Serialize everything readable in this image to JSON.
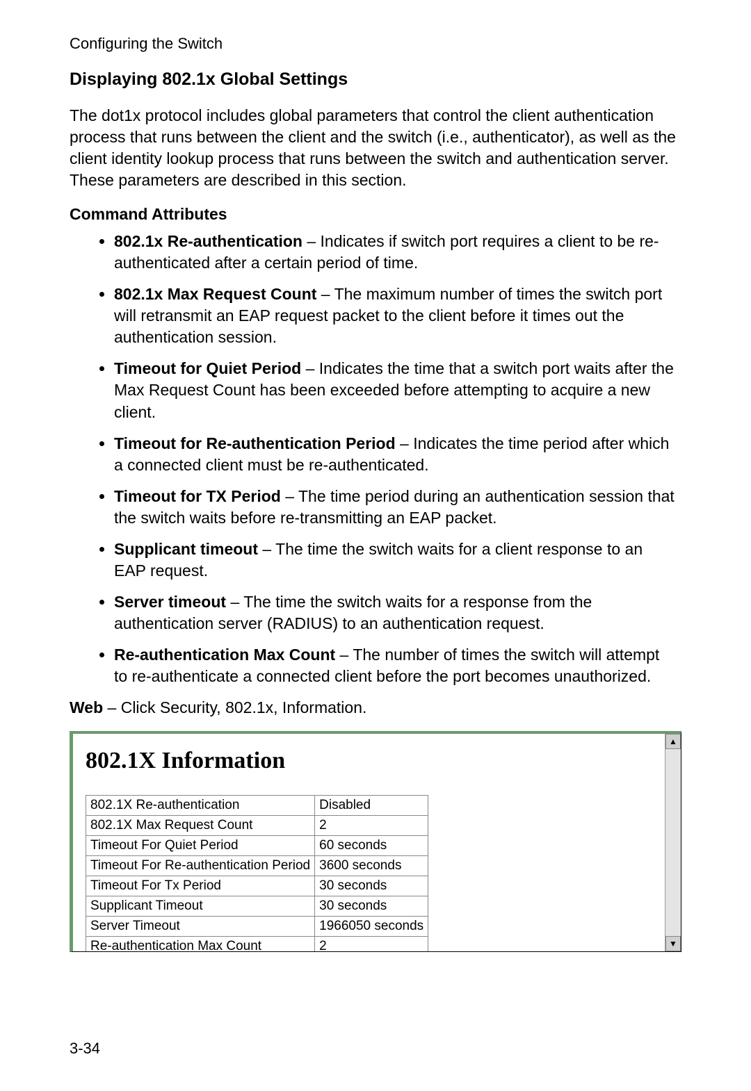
{
  "header": "Configuring the Switch",
  "section_title": "Displaying 802.1x Global Settings",
  "intro": "The dot1x protocol includes global parameters that control the client authentication process that runs between the client and the switch (i.e., authenticator), as well as the client identity lookup process that runs between the switch and authentication server. These parameters are described in this section.",
  "cmd_heading": "Command Attributes",
  "attrs": [
    {
      "term": "802.1x Re-authentication",
      "desc": " – Indicates if switch port requires a client to be re-authenticated after a certain period of time."
    },
    {
      "term": "802.1x Max Request Count",
      "desc": " – The maximum number of times the switch port will retransmit an EAP request packet to the client before it times out the authentication session."
    },
    {
      "term": "Timeout for Quiet Period",
      "desc": " – Indicates the time that a switch port waits after the Max Request Count has been exceeded before attempting to acquire a new client."
    },
    {
      "term": "Timeout for Re-authentication Period",
      "desc": " – Indicates the time period after which a connected client must be re-authenticated."
    },
    {
      "term": "Timeout for TX Period",
      "desc": " – The time period during an authentication session that the switch waits before re-transmitting an EAP packet."
    },
    {
      "term": "Supplicant timeout",
      "desc": " – The time the switch waits for a client response to an EAP request."
    },
    {
      "term": "Server timeout",
      "desc": " – The time the switch waits for a response from the authentication server (RADIUS) to an authentication request."
    },
    {
      "term": "Re-authentication Max Count",
      "desc": " – The number of times the switch will attempt to re-authenticate a connected client before the port becomes unauthorized."
    }
  ],
  "web_prefix": "Web",
  "web_rest": " – Click Security, 802.1x, Information.",
  "shot": {
    "title": "802.1X Information",
    "rows": [
      {
        "label": "802.1X Re-authentication",
        "value": "Disabled"
      },
      {
        "label": "802.1X Max Request Count",
        "value": "2"
      },
      {
        "label": "Timeout For Quiet Period",
        "value": "60 seconds"
      },
      {
        "label": "Timeout For Re-authentication Period",
        "value": "3600 seconds"
      },
      {
        "label": "Timeout For Tx Period",
        "value": "30 seconds"
      },
      {
        "label": "Supplicant Timeout",
        "value": "30 seconds"
      },
      {
        "label": "Server Timeout",
        "value": "1966050 seconds"
      },
      {
        "label": "Re-authentication Max Count",
        "value": "2"
      }
    ]
  },
  "page_number": "3-34"
}
